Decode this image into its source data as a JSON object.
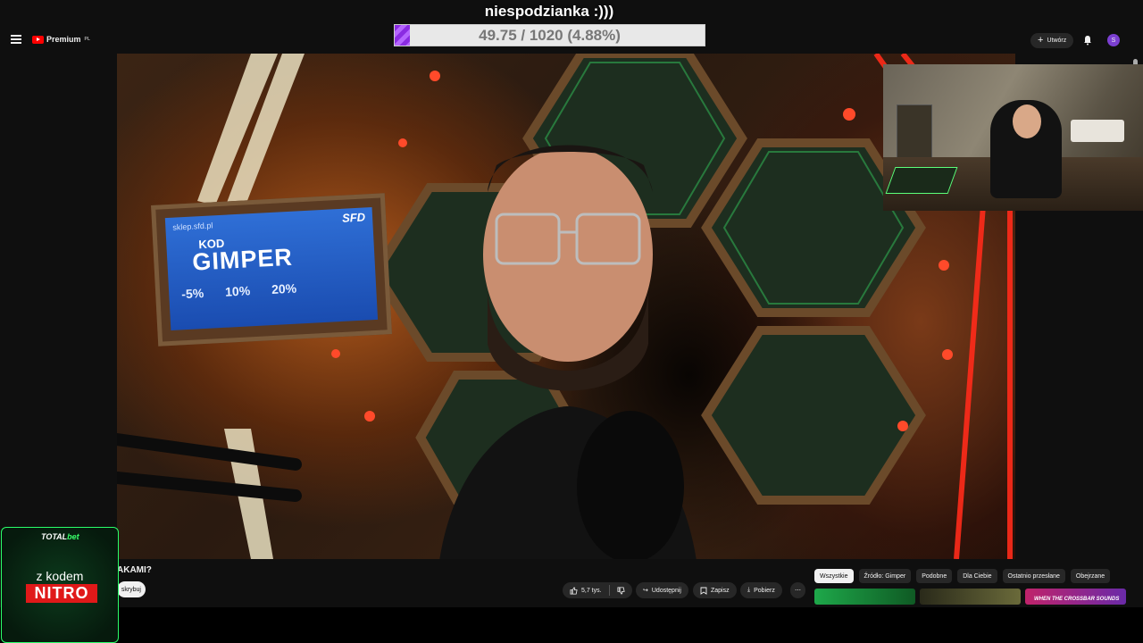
{
  "overlay": {
    "goal_title": "niespodzianka :)))",
    "goal_progress_text": "49.75 / 1020 (4.88%)",
    "goal_progress_fraction": 0.0488,
    "goal_fill_color": "#8a2be2"
  },
  "header": {
    "logo_text": "Premium",
    "logo_region": "PL",
    "create_label": "Utwórz",
    "avatar_letter": "S",
    "icons": [
      "menu-icon",
      "youtube-logo",
      "plus-icon",
      "bell-icon"
    ]
  },
  "video": {
    "sign": {
      "url": "sklep.sfd.pl",
      "brand": "SFD",
      "kod": "KOD",
      "code": "GIMPER",
      "discounts": [
        "-5%",
        "10%",
        "20%"
      ]
    },
    "title_fragment": "AKAMI?"
  },
  "channel": {
    "subscribe_fragment": "skrybuj"
  },
  "actions": {
    "likes": "5,7 tys.",
    "share": "Udostępnij",
    "save": "Zapisz",
    "download": "Pobierz",
    "more": "⋯"
  },
  "chips": [
    "Wszystkie",
    "Źródło: Gimper",
    "Podobne",
    "Dla Ciebie",
    "Ostatnio przesłane",
    "Obejrzane"
  ],
  "thumbnails": [
    {
      "caption": ""
    },
    {
      "caption": ""
    },
    {
      "caption": "WHEN THE CROSSBAR SOUNDS"
    }
  ],
  "sponsor": {
    "brand_prefix": "TOTAL",
    "brand_suffix": "bet",
    "kod_text": "z kodem",
    "code": "NITRO"
  }
}
